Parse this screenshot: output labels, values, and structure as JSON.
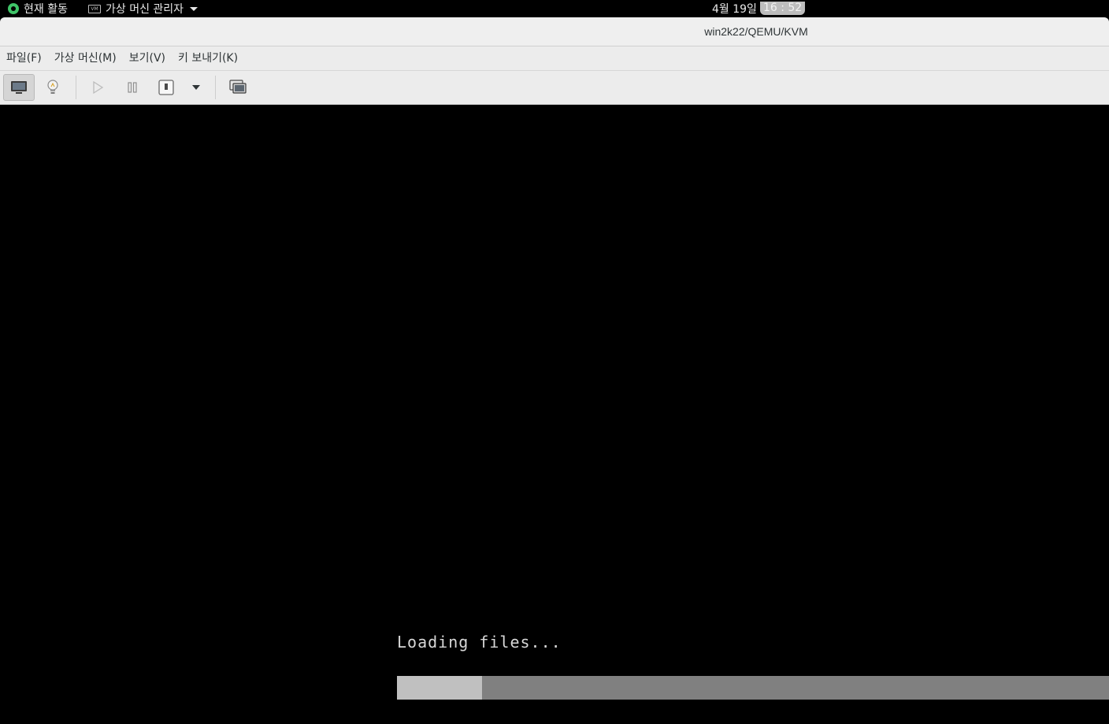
{
  "topbar": {
    "activities_label": "현재 활동",
    "app_menu_label": "가상 머신 관리자",
    "app_icon_text": "VM",
    "date": "4월 19일",
    "time": "16 : 52"
  },
  "window": {
    "title": "win2k22/QEMU/KVM"
  },
  "menubar": {
    "items": [
      "파일(F)",
      "가상 머신(M)",
      "보기(V)",
      "키 보내기(K)"
    ]
  },
  "toolbar": {
    "buttons": [
      "console-view",
      "details-view",
      "run",
      "pause",
      "shutdown",
      "shutdown-options",
      "fullscreen"
    ],
    "active": "console-view"
  },
  "console": {
    "loading_text": "Loading files...",
    "progress_fraction": 0.12
  },
  "colors": {
    "gnome_accent": "#3fc468",
    "progress_fill": "#c0c0c0",
    "progress_track": "#808080"
  }
}
